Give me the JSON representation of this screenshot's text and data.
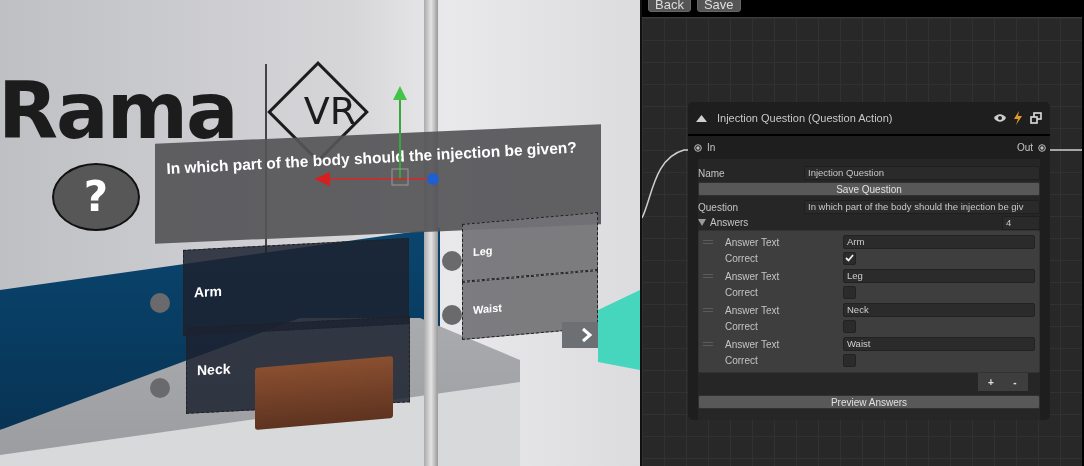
{
  "scene": {
    "logo": {
      "word": "Rama",
      "badge": "VR"
    },
    "help_mark": "?",
    "question": "In which part of the body should the injection be given?",
    "answers": [
      {
        "label": "Arm",
        "kind": "front"
      },
      {
        "label": "Leg",
        "kind": "side"
      },
      {
        "label": "Neck",
        "kind": "front"
      },
      {
        "label": "Waist",
        "kind": "side"
      }
    ]
  },
  "toolbar": {
    "buttons": [
      "Back",
      "Save"
    ]
  },
  "node": {
    "title": "Injection Question (Question Action)",
    "port_in": "In",
    "port_out": "Out",
    "name_label": "Name",
    "name_value": "Injection Question",
    "save_button": "Save Question",
    "question_label": "Question",
    "question_value": "In which part of the body should the injection be giv",
    "answers_label": "Answers",
    "answers_count": "4",
    "answers_expanded": true,
    "answers": [
      {
        "text_label": "Answer Text",
        "text": "Arm",
        "correct_label": "Correct",
        "correct": true
      },
      {
        "text_label": "Answer Text",
        "text": "Leg",
        "correct_label": "Correct",
        "correct": false
      },
      {
        "text_label": "Answer Text",
        "text": "Neck",
        "correct_label": "Correct",
        "correct": false
      },
      {
        "text_label": "Answer Text",
        "text": "Waist",
        "correct_label": "Correct",
        "correct": false
      }
    ],
    "add_button": "+",
    "remove_button": "-",
    "preview_button": "Preview Answers"
  }
}
